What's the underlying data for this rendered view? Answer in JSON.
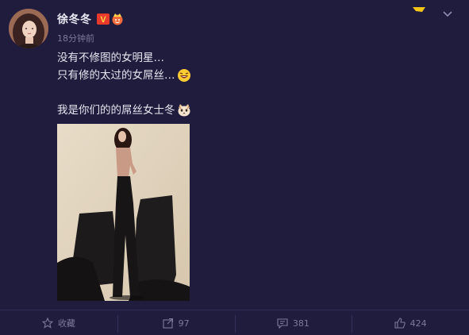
{
  "author": {
    "name": "徐冬冬",
    "verified_badge": "V",
    "level_badge_icon": "fan-badge-icon"
  },
  "post": {
    "timestamp": "18分钟前",
    "lines": [
      "没有不修图的女明星…",
      "只有修的太过的女屌丝…",
      "",
      "我是你们的的屌丝女士冬"
    ],
    "line2_emoji": "laughing-face-icon",
    "line4_emoji": "cat-face-icon"
  },
  "actions": {
    "favorite": {
      "label": "收藏",
      "icon": "star-icon"
    },
    "repost": {
      "label": "97",
      "icon": "share-icon"
    },
    "comment": {
      "label": "381",
      "icon": "comment-icon"
    },
    "like": {
      "label": "424",
      "icon": "thumbs-up-icon"
    }
  },
  "colors": {
    "background": "#201c3e",
    "text": "#e6e6f0",
    "muted": "#7d7a9c",
    "verified": "#e8392b",
    "accent_yellow": "#f5c518"
  }
}
